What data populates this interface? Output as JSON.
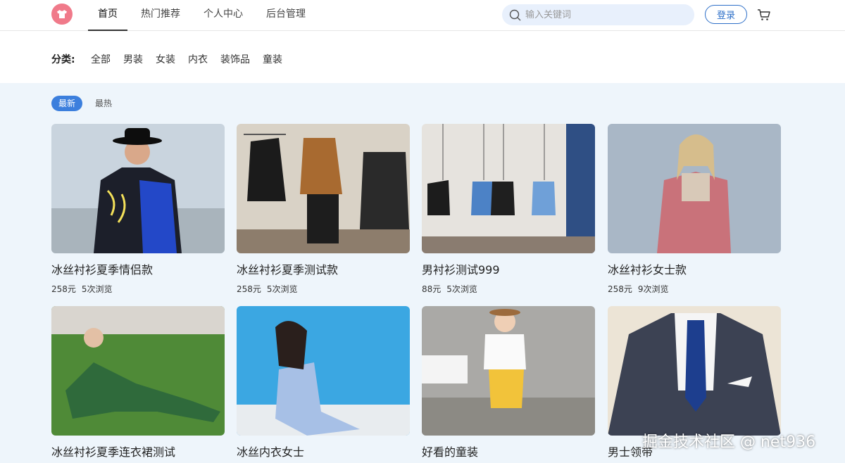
{
  "header": {
    "nav": [
      "首页",
      "热门推荐",
      "个人中心",
      "后台管理"
    ],
    "search_placeholder": "输入关键词",
    "login_label": "登录"
  },
  "categories": {
    "label": "分类:",
    "items": [
      "全部",
      "男装",
      "女装",
      "内衣",
      "装饰品",
      "童装"
    ]
  },
  "sort_tabs": [
    "最新",
    "最热"
  ],
  "products": [
    {
      "title": "冰丝衬衫夏季情侣款",
      "price": "258元",
      "views": "5次浏览"
    },
    {
      "title": "冰丝衬衫夏季测试款",
      "price": "258元",
      "views": "5次浏览"
    },
    {
      "title": "男衬衫测试999",
      "price": "88元",
      "views": "5次浏览"
    },
    {
      "title": "冰丝衬衫女士款",
      "price": "258元",
      "views": "9次浏览"
    },
    {
      "title": "冰丝衬衫夏季连衣裙测试",
      "price": "",
      "views": ""
    },
    {
      "title": "冰丝内衣女士",
      "price": "",
      "views": ""
    },
    {
      "title": "好看的童装",
      "price": "",
      "views": ""
    },
    {
      "title": "男士领带",
      "price": "",
      "views": ""
    }
  ],
  "watermark": "掘金技术社区 @ net936",
  "colors": {
    "accent": "#3c7fdd",
    "logo": "#f07a8a",
    "search_bg": "#e8f0fc",
    "page_bg": "#eef5fb"
  }
}
